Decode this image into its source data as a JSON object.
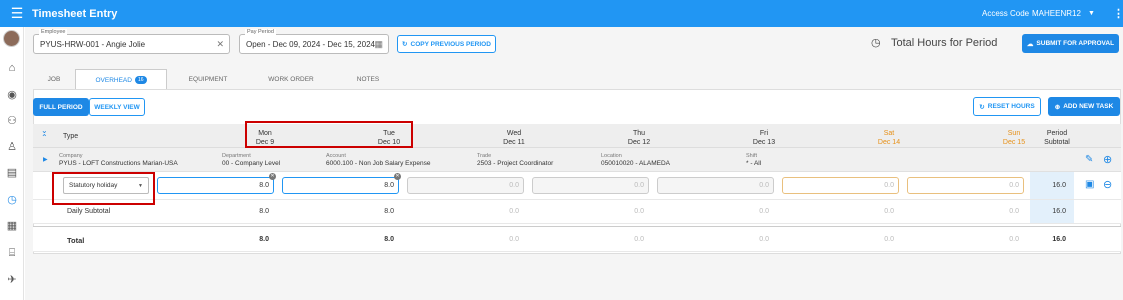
{
  "app": {
    "title": "Timesheet Entry",
    "access_code_label": "Access Code",
    "access_code_value": "MAHEENR12"
  },
  "employee": {
    "label": "Employee",
    "value": "PYUS-HRW-001 - Angie Jolie"
  },
  "pay_period": {
    "label": "Pay Period",
    "value": "Open - Dec 09, 2024 - Dec 15, 2024"
  },
  "copy_btn": "COPY PREVIOUS PERIOD",
  "total_hours_label": "Total Hours for Period",
  "submit_btn": "SUBMIT FOR APPROVAL",
  "tabs": [
    {
      "label": "JOB"
    },
    {
      "label": "OVERHEAD",
      "badge": "16"
    },
    {
      "label": "EQUIPMENT"
    },
    {
      "label": "WORK ORDER"
    },
    {
      "label": "NOTES"
    }
  ],
  "view": {
    "full": "FULL PERIOD",
    "weekly": "WEEKLY VIEW"
  },
  "reset_btn": "RESET HOURS",
  "add_task_btn": "ADD NEW TASK",
  "header": {
    "type": "Type",
    "period_subtotal_1": "Period",
    "period_subtotal_2": "Subtotal"
  },
  "days": [
    {
      "name": "Mon",
      "date": "Dec 9"
    },
    {
      "name": "Tue",
      "date": "Dec 10"
    },
    {
      "name": "Wed",
      "date": "Dec 11"
    },
    {
      "name": "Thu",
      "date": "Dec 12"
    },
    {
      "name": "Fri",
      "date": "Dec 13"
    },
    {
      "name": "Sat",
      "date": "Dec 14"
    },
    {
      "name": "Sun",
      "date": "Dec 15"
    }
  ],
  "group": {
    "company_k": "Company",
    "company_v": "PYUS - LOFT Constructions Marian-USA",
    "dept_k": "Department",
    "dept_v": "00 - Company Level",
    "account_k": "Account",
    "account_v": "6000.100 - Non Job Salary Expense",
    "trade_k": "Trade",
    "trade_v": "2503 - Project Coordinator",
    "location_k": "Location",
    "location_v": "050010020 - ALAMEDA",
    "shift_k": "Shift",
    "shift_v": "* - All"
  },
  "entry": {
    "type": "Statutory holiday",
    "hours": [
      "8.0",
      "8.0",
      "0.0",
      "0.0",
      "0.0",
      "0.0",
      "0.0"
    ],
    "subtotal": "16.0"
  },
  "daily": {
    "label": "Daily Subtotal",
    "hours": [
      "8.0",
      "8.0",
      "0.0",
      "0.0",
      "0.0",
      "0.0",
      "0.0"
    ],
    "subtotal": "16.0"
  },
  "total": {
    "label": "Total",
    "hours": [
      "8.0",
      "8.0",
      "0.0",
      "0.0",
      "0.0",
      "0.0",
      "0.0"
    ],
    "subtotal": "16.0"
  }
}
